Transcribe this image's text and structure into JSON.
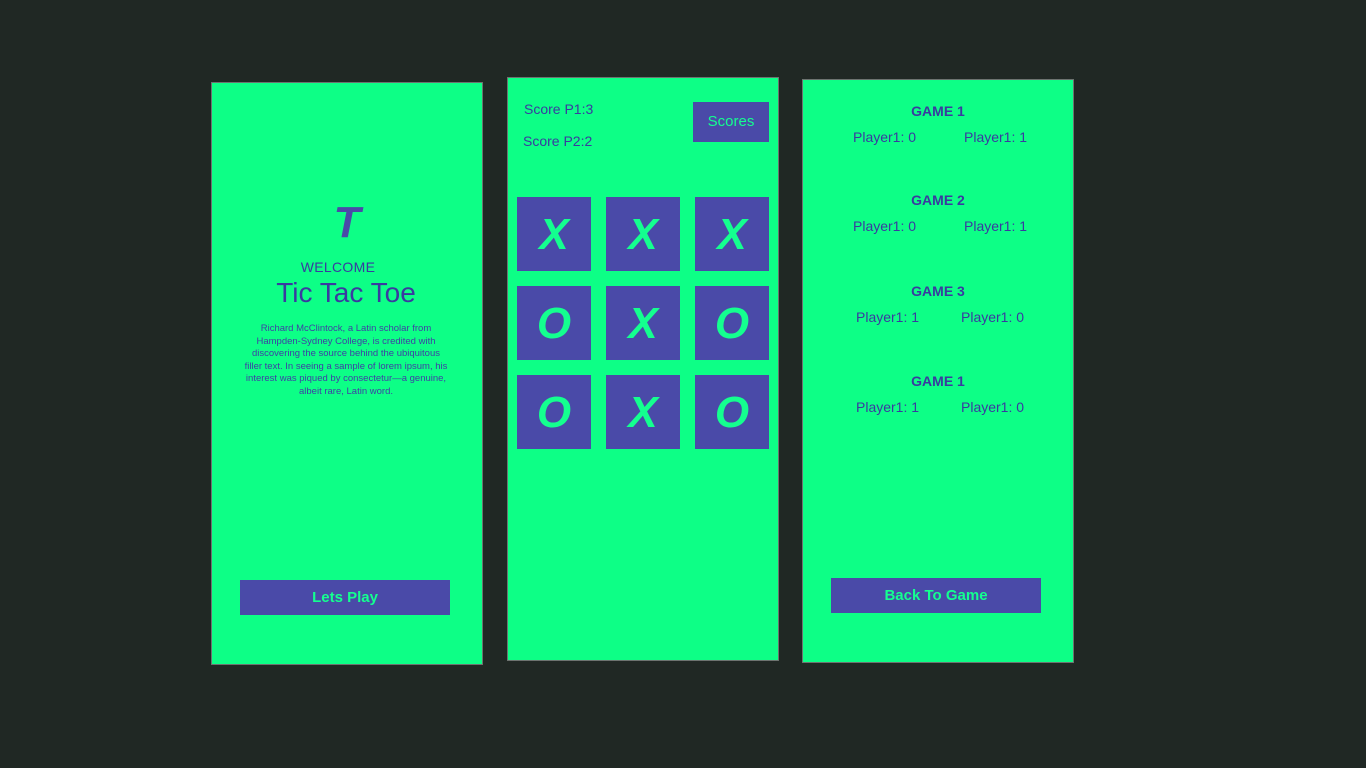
{
  "welcome_screen": {
    "logo": "T",
    "welcome": "WELCOME",
    "title": "Tic Tac Toe",
    "description": "Richard McClintock, a Latin scholar from Hampden-Sydney College, is credited with discovering the source behind the ubiquitous filler text. In seeing a sample of lorem ipsum, his interest was piqued by consectetur—a genuine, albeit rare, Latin word.",
    "play_button": "Lets Play"
  },
  "game_screen": {
    "score_p1": "Score P1:3",
    "score_p2": "Score P2:2",
    "scores_button": "Scores",
    "board": [
      "X",
      "X",
      "X",
      "O",
      "X",
      "O",
      "O",
      "X",
      "O"
    ]
  },
  "scores_screen": {
    "games": [
      {
        "title": "GAME 1",
        "left": "Player1: 0",
        "right": "Player1: 1"
      },
      {
        "title": "GAME 2",
        "left": "Player1: 0",
        "right": "Player1: 1"
      },
      {
        "title": "GAME 3",
        "left": "Player1: 1",
        "right": "Player1: 0"
      },
      {
        "title": "GAME 1",
        "left": "Player1: 1",
        "right": "Player1: 0"
      }
    ],
    "back_button": "Back To Game"
  },
  "colors": {
    "background": "#202824",
    "panel": "#0dff86",
    "accent": "#4a4aa8"
  }
}
